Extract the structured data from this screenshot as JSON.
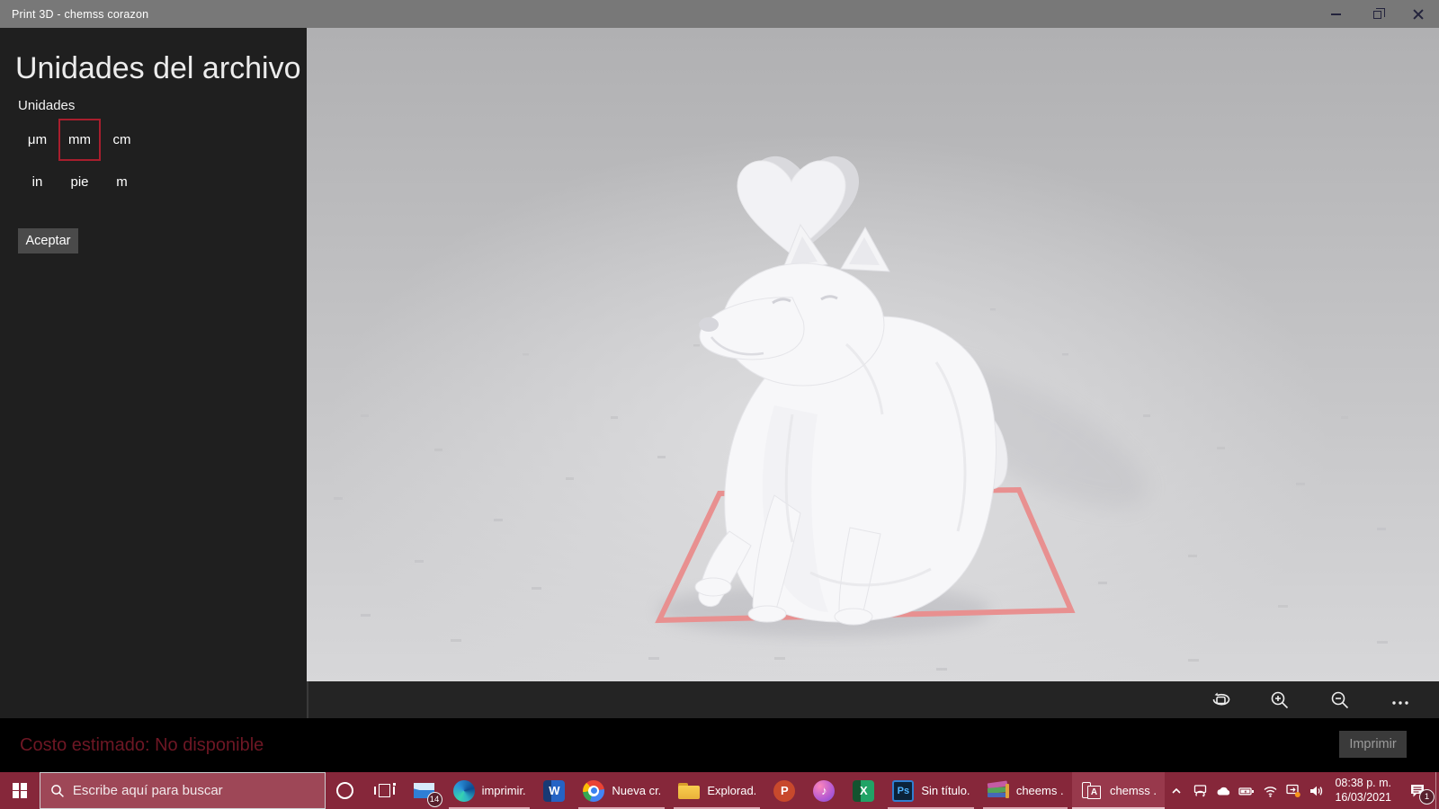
{
  "window": {
    "title": "Print 3D - chemss corazon"
  },
  "units_panel": {
    "title": "Unidades del archivo",
    "group_label": "Unidades",
    "units": [
      {
        "label": "μm",
        "selected": false
      },
      {
        "label": "mm",
        "selected": true
      },
      {
        "label": "cm",
        "selected": false
      },
      {
        "label": "in",
        "selected": false
      },
      {
        "label": "pie",
        "selected": false
      },
      {
        "label": "m",
        "selected": false
      }
    ],
    "accept_label": "Aceptar"
  },
  "status_bar": {
    "cost_text": "Costo estimado: No disponible",
    "print_label": "Imprimir"
  },
  "taskbar": {
    "search_placeholder": "Escribe aquí para buscar",
    "apps": [
      {
        "name": "cortana"
      },
      {
        "name": "task-view"
      },
      {
        "name": "mail",
        "badge": "14"
      },
      {
        "name": "edge",
        "label": "imprimir...",
        "open": true
      },
      {
        "name": "word"
      },
      {
        "name": "chrome",
        "label": "Nueva cr...",
        "open": true
      },
      {
        "name": "explorer",
        "label": "Explorad...",
        "open": true
      },
      {
        "name": "powerpoint"
      },
      {
        "name": "itunes"
      },
      {
        "name": "excel"
      },
      {
        "name": "photoshop",
        "label": "Sin título...",
        "open": true
      },
      {
        "name": "winrar",
        "label": "cheems ...",
        "open": true
      },
      {
        "name": "print3d",
        "label": "chemss ...",
        "open": true,
        "active": true
      }
    ],
    "tray": {
      "time": "08:38 p. m.",
      "date": "16/03/2021",
      "notification_badge": "1"
    }
  },
  "colors": {
    "titlebar": "#787878",
    "sidebar": "#1f1f1f",
    "taskbar": "#86273a",
    "selected_unit_border": "#a81e2d",
    "bed_outline": "#e89090",
    "cost_text": "#6e1724"
  },
  "icons": {
    "minimize-icon": "window-minimize",
    "restore-icon": "window-restore",
    "close-icon": "window-close",
    "search-icon": "magnifier",
    "windows-start-icon": "windows-logo",
    "reset-view-icon": "orbit-camera",
    "zoom-in-icon": "magnifier-plus",
    "zoom-out-icon": "magnifier-minus",
    "more-icon": "ellipsis",
    "tray-chevron-icon": "chevron-up",
    "cast-icon": "wireless-display",
    "onedrive-icon": "cloud",
    "battery-icon": "battery-charging",
    "wifi-icon": "wifi",
    "screen-sync-icon": "display-sync-orange-dot",
    "volume-icon": "speaker",
    "action-center-icon": "notifications"
  }
}
